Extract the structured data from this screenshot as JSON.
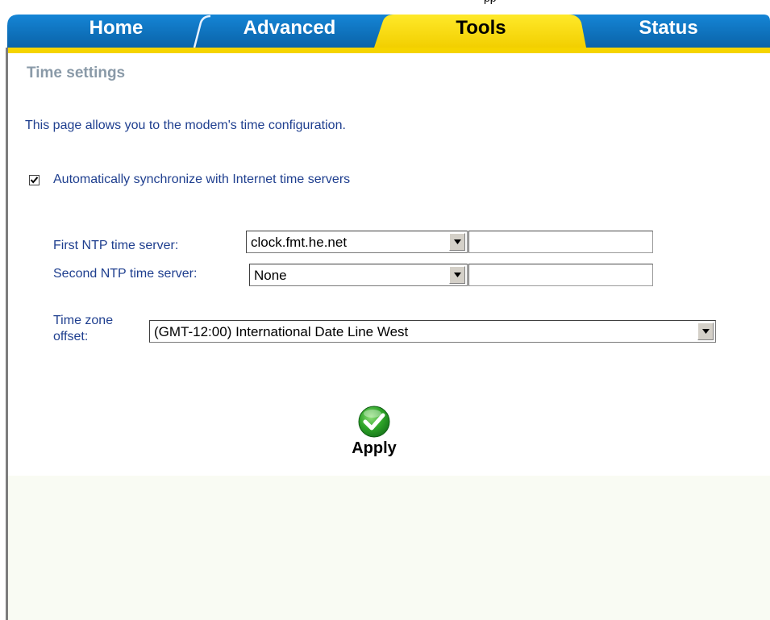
{
  "top_cut_text": "pp",
  "tabs": {
    "home": "Home",
    "advanced": "Advanced",
    "tools": "Tools",
    "status": "Status"
  },
  "page": {
    "title": "Time settings",
    "description": "This page allows you to the modem's time configuration."
  },
  "sync": {
    "label": "Automatically synchronize with Internet time servers",
    "checked": true
  },
  "ntp": {
    "first_label": "First NTP time server:",
    "first_value": "clock.fmt.he.net",
    "first_custom": "",
    "second_label": "Second NTP time server:",
    "second_value": "None",
    "second_custom": ""
  },
  "timezone": {
    "label_line1": "Time zone",
    "label_line2": "offset:",
    "value": "(GMT-12:00) International Date Line West"
  },
  "apply": {
    "label": "Apply"
  },
  "colors": {
    "tab_blue": "#0b6db8",
    "tab_yellow": "#f5d400",
    "text_blue": "#1f3f8f",
    "title_gray": "#8a9aa8",
    "apply_green": "#2ea428"
  },
  "icons": {
    "checkbox": "check-icon",
    "dropdown": "chevron-down-icon",
    "apply": "green-check-icon"
  }
}
